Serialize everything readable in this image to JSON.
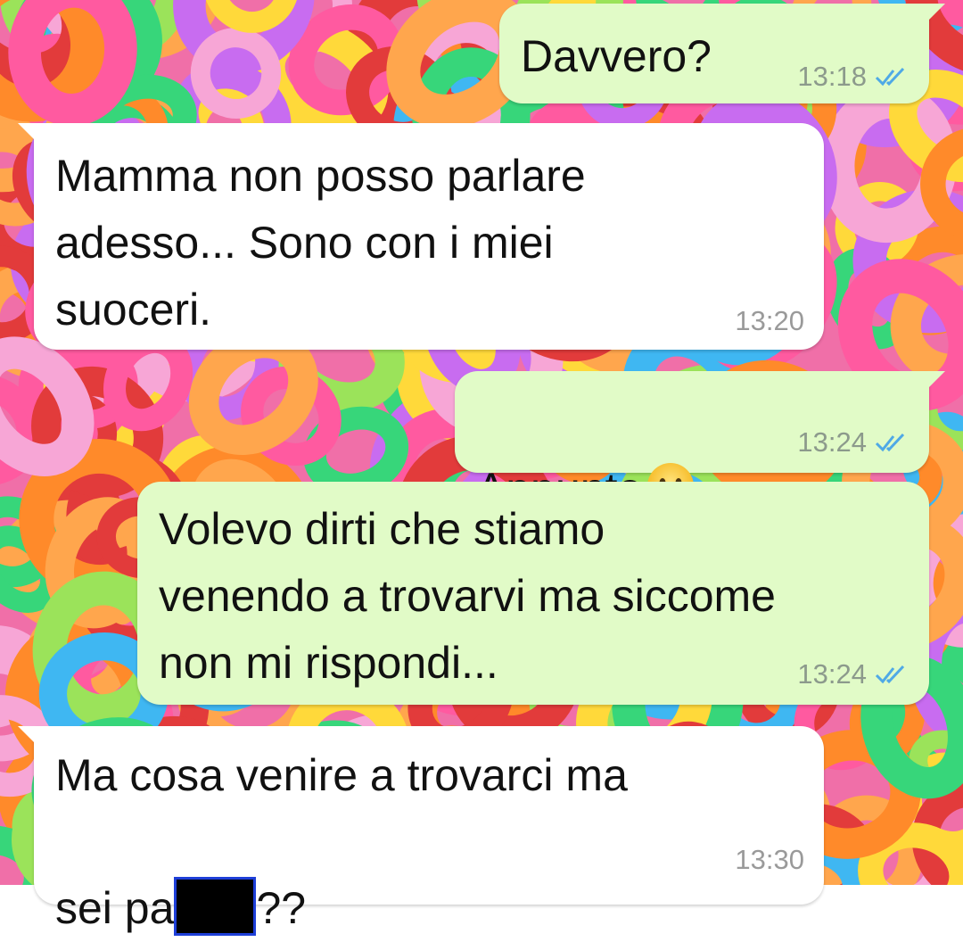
{
  "chat": {
    "messages": [
      {
        "direction": "out",
        "text": "Davvero?",
        "time": "13:18",
        "status": "read"
      },
      {
        "direction": "in",
        "text": "Mamma non posso parlare\nadesso... Sono con i miei\nsuoceri.",
        "time": "13:20"
      },
      {
        "direction": "out",
        "text": "Appunto",
        "emoji": "neutral-face",
        "time": "13:24",
        "status": "read"
      },
      {
        "direction": "out",
        "text": "Volevo dirti che stiamo\nvenendo a trovarvi ma siccome\nnon mi rispondi...",
        "time": "13:24",
        "status": "read"
      },
      {
        "direction": "in",
        "text_line1": "Ma cosa venire a trovarci ma",
        "text_line2_prefix": "sei pa",
        "text_line2_suffix": "??",
        "time": "13:30"
      }
    ]
  },
  "colors": {
    "outgoing_bubble": "#e1fbc7",
    "incoming_bubble": "#ffffff",
    "read_ticks": "#4fa9e6",
    "redaction_border": "#1e3fd8"
  }
}
